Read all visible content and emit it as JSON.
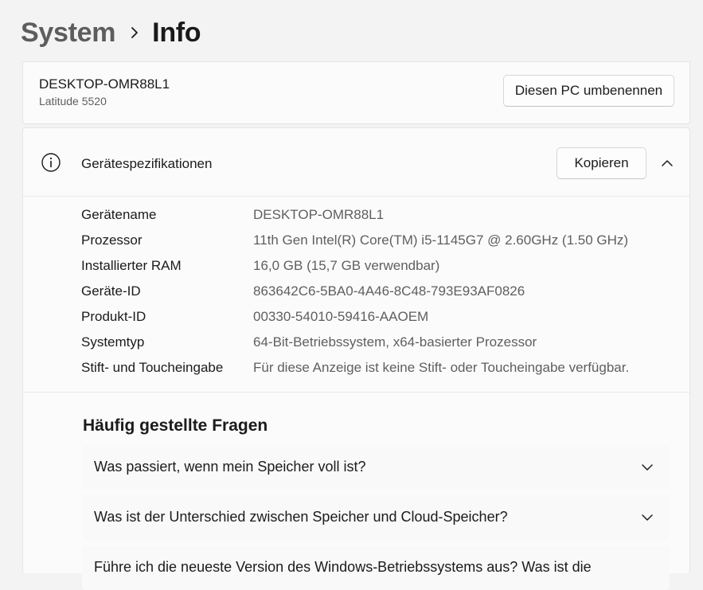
{
  "breadcrumb": {
    "parent": "System",
    "current": "Info"
  },
  "device": {
    "name": "DESKTOP-OMR88L1",
    "model": "Latitude 5520",
    "rename_button": "Diesen PC umbenennen"
  },
  "specs": {
    "title": "Gerätespezifikationen",
    "copy_button": "Kopieren",
    "rows": [
      {
        "label": "Gerätename",
        "value": "DESKTOP-OMR88L1"
      },
      {
        "label": "Prozessor",
        "value": "11th Gen Intel(R) Core(TM) i5-1145G7 @ 2.60GHz (1.50 GHz)"
      },
      {
        "label": "Installierter RAM",
        "value": "16,0 GB (15,7 GB verwendbar)"
      },
      {
        "label": "Geräte-ID",
        "value": "863642C6-5BA0-4A46-8C48-793E93AF0826"
      },
      {
        "label": "Produkt-ID",
        "value": "00330-54010-59416-AAOEM"
      },
      {
        "label": "Systemtyp",
        "value": "64-Bit-Betriebssystem, x64-basierter Prozessor"
      },
      {
        "label": "Stift- und Toucheingabe",
        "value": "Für diese Anzeige ist keine Stift- oder Toucheingabe verfügbar."
      }
    ]
  },
  "faq": {
    "title": "Häufig gestellte Fragen",
    "items": [
      {
        "question": "Was passiert, wenn mein Speicher voll ist?"
      },
      {
        "question": "Was ist der Unterschied zwischen Speicher und Cloud-Speicher?"
      },
      {
        "question": "Führe ich die neueste Version des Windows-Betriebssystems aus? Was ist die"
      }
    ]
  },
  "icons": {
    "breadcrumb_separator": "chevron-right-icon",
    "specs": "info-icon",
    "collapse": "chevron-up-icon",
    "expand": "chevron-down-icon"
  },
  "colors": {
    "background": "#f3f3f3",
    "card": "#fbfbfb",
    "border": "#e5e5e5",
    "secondary_text": "#5f5f5f"
  }
}
